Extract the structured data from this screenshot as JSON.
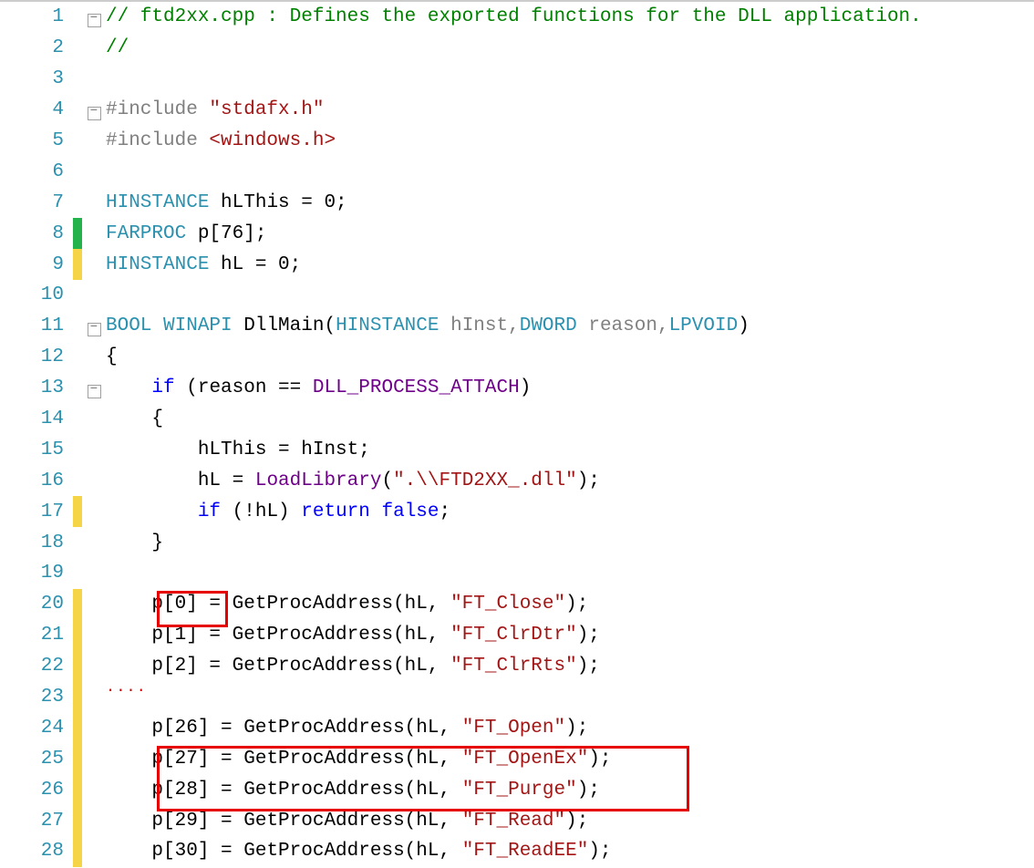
{
  "lines": {
    "l1": {
      "n": "1",
      "comment": "// ftd2xx.cpp : Defines the exported functions for the DLL application."
    },
    "l2": {
      "n": "2",
      "comment": "//"
    },
    "l3": {
      "n": "3"
    },
    "l4": {
      "n": "4",
      "macro": "#include ",
      "string": "\"stdafx.h\""
    },
    "l5": {
      "n": "5",
      "macro": "#include ",
      "string": "<windows.h>"
    },
    "l6": {
      "n": "6"
    },
    "l7": {
      "n": "7",
      "type": "HINSTANCE ",
      "rest": "hLThis = 0;"
    },
    "l8": {
      "n": "8",
      "type": "FARPROC ",
      "rest": "p[76];"
    },
    "l9": {
      "n": "9",
      "type": "HINSTANCE ",
      "rest": "hL = 0;"
    },
    "l10": {
      "n": "10"
    },
    "l11": {
      "n": "11",
      "type1": "BOOL ",
      "type2": "WINAPI ",
      "func": "DllMain(",
      "type3": "HINSTANCE ",
      "arg1": "hInst,",
      "type4": "DWORD ",
      "arg2": "reason,",
      "type5": "LPVOID",
      "close": ")"
    },
    "l12": {
      "n": "12",
      "plain": "{"
    },
    "l13": {
      "n": "13",
      "indent": "    ",
      "kw": "if ",
      "open": "(reason == ",
      "macro": "DLL_PROCESS_ATTACH",
      "close": ")"
    },
    "l14": {
      "n": "14",
      "plain": "    {"
    },
    "l15": {
      "n": "15",
      "plain": "        hLThis = hInst;"
    },
    "l16": {
      "n": "16",
      "indent": "        ",
      "plain1": "hL = ",
      "func": "LoadLibrary",
      "open": "(",
      "string": "\".\\\\FTD2XX_.dll\"",
      "close": ");"
    },
    "l17": {
      "n": "17",
      "indent": "        ",
      "kw1": "if ",
      "mid": "(!hL) ",
      "kw2": "return ",
      "kw3": "false",
      "end": ";"
    },
    "l18": {
      "n": "18",
      "plain": "    }"
    },
    "l19": {
      "n": "19"
    },
    "l20": {
      "n": "20",
      "indent": "    ",
      "plain1": "p[0] = GetProcAddress(hL, ",
      "string": "\"FT_Close\"",
      "close": ");"
    },
    "l21": {
      "n": "21",
      "indent": "    ",
      "plain1": "p[1] = GetProcAddress(hL, ",
      "string": "\"FT_ClrDtr\"",
      "close": ");"
    },
    "l22": {
      "n": "22",
      "indent": "    ",
      "plain1": "p[2] = GetProcAddress(hL, ",
      "string": "\"FT_ClrRts\"",
      "close": ");"
    },
    "l23": {
      "n": "23"
    },
    "l24": {
      "n": "24",
      "indent": "    ",
      "plain1": "p[26] = GetProcAddress(hL, ",
      "string": "\"FT_Open\"",
      "close": ");"
    },
    "l25": {
      "n": "25",
      "indent": "    ",
      "plain1": "p[27] = GetProcAddress(hL, ",
      "string": "\"FT_OpenEx\"",
      "close": ");"
    },
    "l26": {
      "n": "26",
      "indent": "    ",
      "plain1": "p[28] = GetProcAddress(hL, ",
      "string": "\"FT_Purge\"",
      "close": ");"
    },
    "l27": {
      "n": "27",
      "indent": "    ",
      "plain1": "p[29] = GetProcAddress(hL, ",
      "string": "\"FT_Read\"",
      "close": ");"
    },
    "l28": {
      "n": "28",
      "indent": "    ",
      "plain1": "p[30] = GetProcAddress(hL, ",
      "string": "\"FT_ReadEE\"",
      "close": ");"
    }
  },
  "squiggle": "...."
}
